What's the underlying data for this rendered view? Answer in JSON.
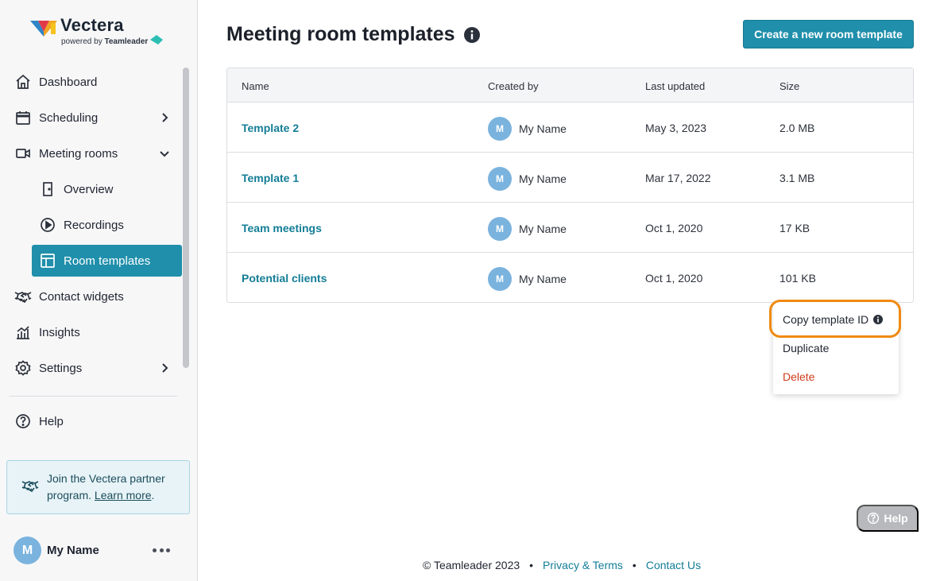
{
  "brand": {
    "name": "Vectera",
    "powered_prefix": "powered by",
    "powered_name": "Teamleader"
  },
  "sidebar": {
    "items": [
      {
        "label": "Dashboard",
        "icon": "home-icon"
      },
      {
        "label": "Scheduling",
        "icon": "calendar-icon"
      },
      {
        "label": "Meeting rooms",
        "icon": "video-camera-icon"
      },
      {
        "label": "Overview",
        "icon": "door-icon"
      },
      {
        "label": "Recordings",
        "icon": "play-circle-icon"
      },
      {
        "label": "Room templates",
        "icon": "layout-template-icon"
      },
      {
        "label": "Contact widgets",
        "icon": "handshake-icon"
      },
      {
        "label": "Insights",
        "icon": "chart-icon"
      },
      {
        "label": "Settings",
        "icon": "gear-icon"
      },
      {
        "label": "Help",
        "icon": "question-circle-icon"
      }
    ],
    "partner": {
      "text": "Join the Vectera partner program.",
      "before_link": "Join the Vectera partner program. ",
      "link": "Learn more",
      "after_link": "."
    },
    "user": {
      "initial": "M",
      "name": "My Name"
    }
  },
  "main": {
    "title": "Meeting room templates",
    "create_button": "Create a new room template",
    "table": {
      "headers": {
        "name": "Name",
        "created_by": "Created by",
        "last_updated": "Last updated",
        "size": "Size"
      },
      "rows": [
        {
          "name": "Template 2",
          "initial": "M",
          "creator": "My Name",
          "updated": "May 3, 2023",
          "size": "2.0 MB"
        },
        {
          "name": "Template 1",
          "initial": "M",
          "creator": "My Name",
          "updated": "Mar 17, 2022",
          "size": "3.1 MB"
        },
        {
          "name": "Team meetings",
          "initial": "M",
          "creator": "My Name",
          "updated": "Oct 1, 2020",
          "size": "17 KB"
        },
        {
          "name": "Potential clients",
          "initial": "M",
          "creator": "My Name",
          "updated": "Oct 1, 2020",
          "size": "101 KB"
        }
      ]
    },
    "context_menu": {
      "copy": "Copy template ID",
      "duplicate": "Duplicate",
      "delete": "Delete"
    }
  },
  "help_button": "Help",
  "footer": {
    "copyright": "© Teamleader 2023",
    "privacy": "Privacy & Terms",
    "contact": "Contact Us"
  },
  "colors": {
    "accent": "#1f8fab",
    "link": "#137d96",
    "danger": "#d03b1a",
    "highlight": "#f08a12"
  }
}
